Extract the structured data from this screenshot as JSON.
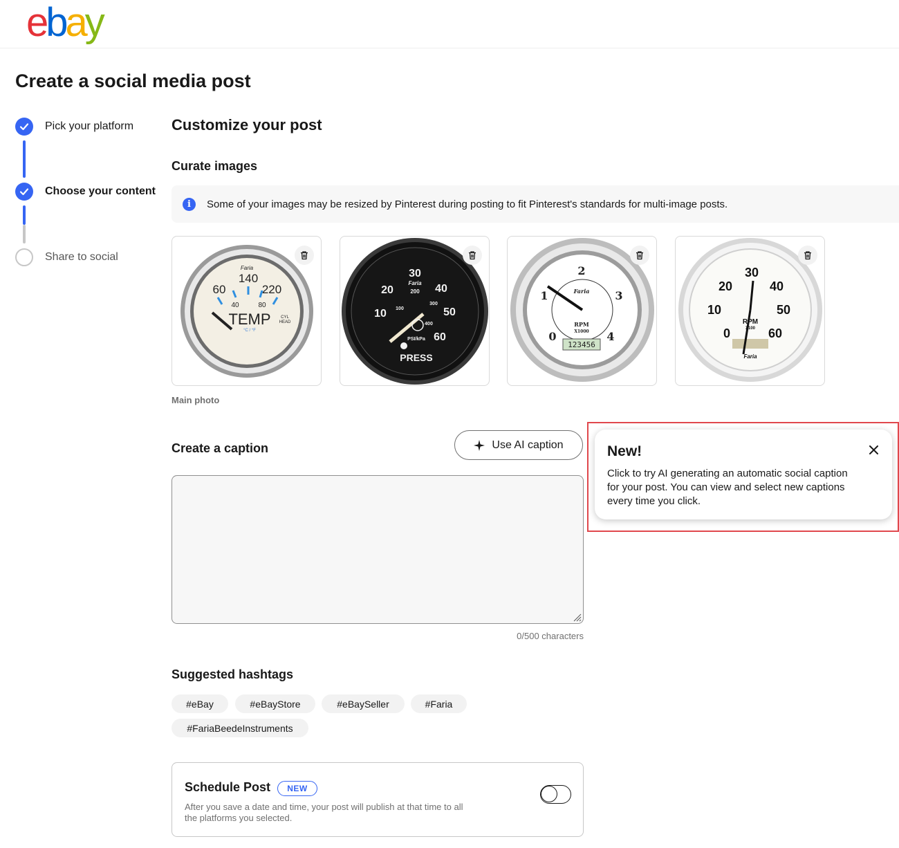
{
  "header": {
    "logo_letters": [
      "e",
      "b",
      "a",
      "y"
    ],
    "logo_colors": [
      "#e53238",
      "#0064d2",
      "#f5af02",
      "#86b817"
    ]
  },
  "page": {
    "title": "Create a social media post"
  },
  "stepper": {
    "steps": [
      {
        "label": "Pick your platform",
        "state": "complete"
      },
      {
        "label": "Choose your content",
        "state": "complete-current"
      },
      {
        "label": "Share to social",
        "state": "pending"
      }
    ]
  },
  "main": {
    "heading": "Customize your post",
    "images_heading": "Curate images",
    "notice": "Some of your images may be resized by Pinterest during posting to fit Pinterest's standards for multi-image posts.",
    "images": [
      {
        "name": "temperature gauge",
        "delete_icon": "trash-icon",
        "labels": [
          "Faria",
          "140",
          "60",
          "220",
          "40",
          "80",
          "TEMP",
          "CYL",
          "HEAD",
          "°C / °F"
        ]
      },
      {
        "name": "pressure gauge",
        "delete_icon": "trash-icon",
        "labels": [
          "30",
          "Faria",
          "20",
          "200",
          "40",
          "100",
          "300",
          "10",
          "50",
          "400",
          "PSI/kPa",
          "60",
          "PRESS"
        ]
      },
      {
        "name": "tachometer",
        "delete_icon": "trash-icon",
        "labels": [
          "2",
          "Faria",
          "1",
          "3",
          "RPM",
          "X1000",
          "0",
          "4",
          "123456"
        ]
      },
      {
        "name": "speedometer",
        "delete_icon": "trash-icon",
        "labels": [
          "30",
          "20",
          "40",
          "10",
          "50",
          "RPM",
          "X100",
          "0",
          "60",
          "Faria"
        ]
      }
    ],
    "main_photo_label": "Main photo",
    "caption_heading": "Create a caption",
    "ai_button_label": "Use AI caption",
    "caption_value": "",
    "char_count": "0/500 characters",
    "hashtags_heading": "Suggested hashtags",
    "hashtags": [
      "#eBay",
      "#eBayStore",
      "#eBaySeller",
      "#Faria",
      "#FariaBeedeInstruments"
    ],
    "schedule": {
      "title": "Schedule Post",
      "badge": "NEW",
      "description": "After you save a date and time, your post will publish at that time to all the platforms you selected.",
      "enabled": false
    }
  },
  "popover": {
    "title": "New!",
    "text": "Click to try AI generating an automatic social caption for your post. You can view and select new captions every time you click.",
    "close_icon": "close-icon"
  },
  "colors": {
    "accent": "#3665f3",
    "highlight": "#e0474c"
  }
}
